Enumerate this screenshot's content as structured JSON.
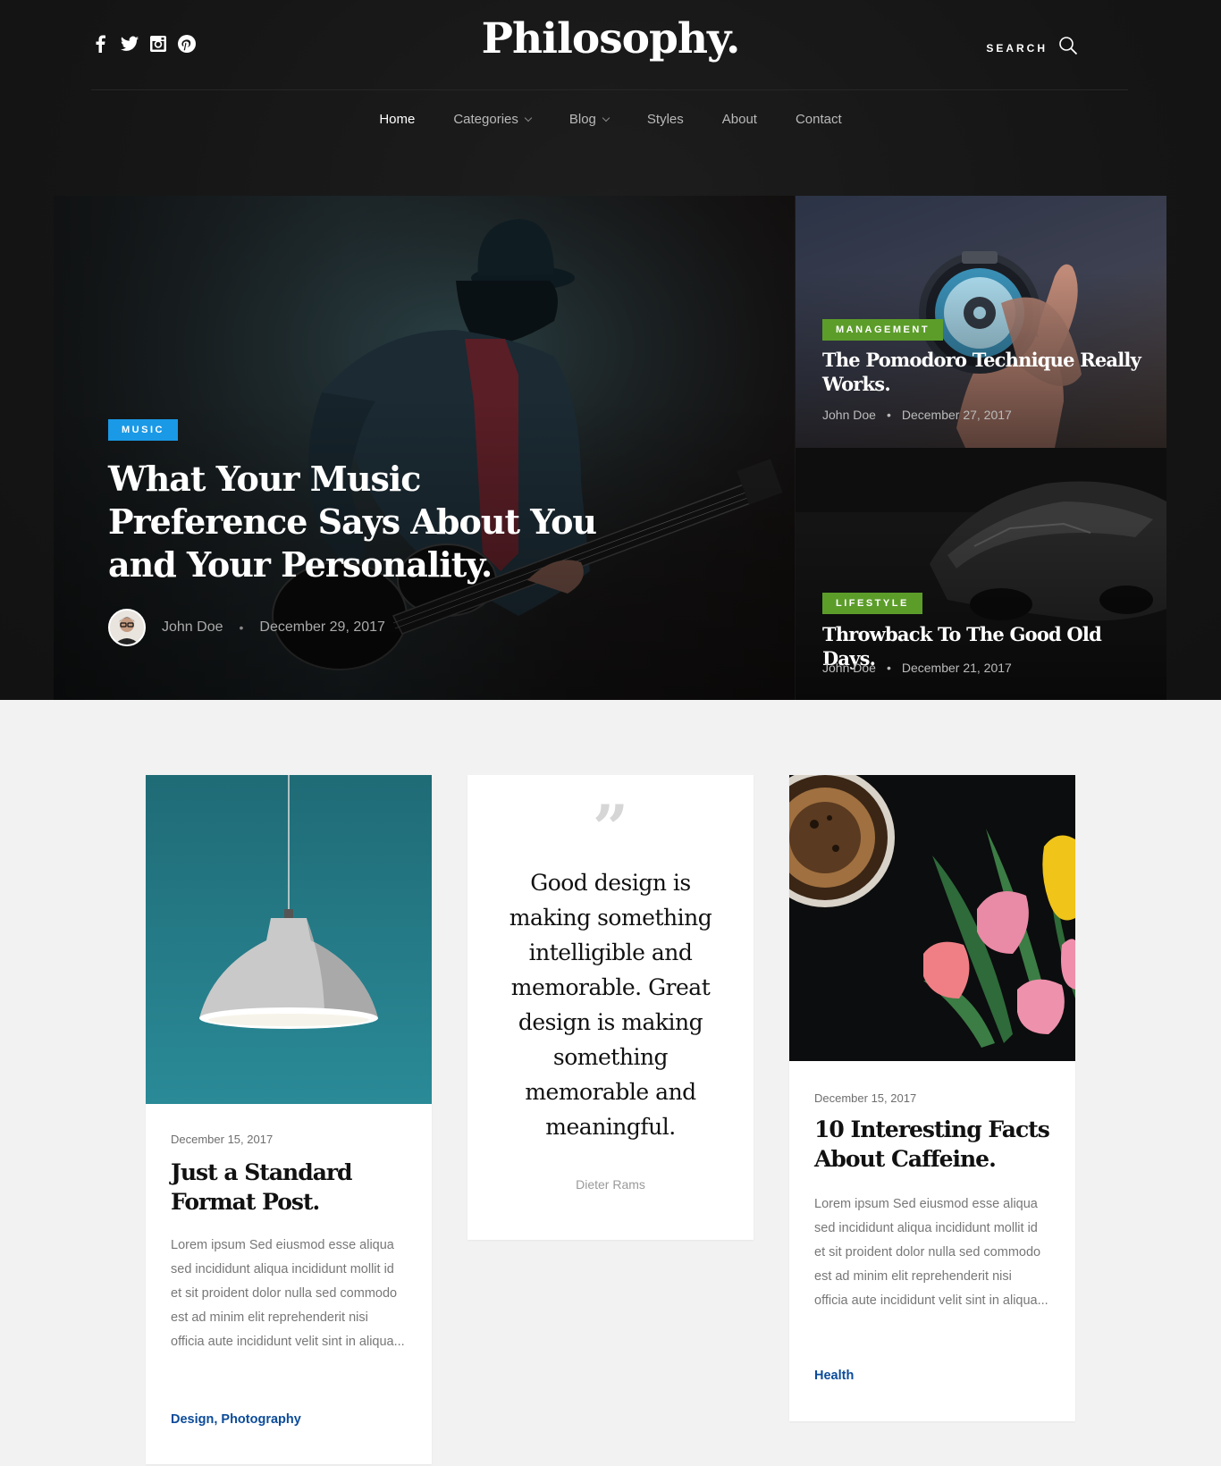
{
  "header": {
    "logo": "Philosophy.",
    "search_label": "SEARCH",
    "social": [
      "facebook-icon",
      "twitter-icon",
      "instagram-icon",
      "pinterest-icon"
    ]
  },
  "nav": {
    "items": [
      {
        "label": "Home",
        "active": true
      },
      {
        "label": "Categories",
        "dropdown": true
      },
      {
        "label": "Blog",
        "dropdown": true
      },
      {
        "label": "Styles"
      },
      {
        "label": "About"
      },
      {
        "label": "Contact"
      }
    ]
  },
  "featured": {
    "main": {
      "category": "MUSIC",
      "category_color": "#1a99e6",
      "title": "What Your Music Preference Says About You and Your Personality.",
      "author": "John Doe",
      "separator": "•",
      "date": "December 29, 2017"
    },
    "side": [
      {
        "category": "MANAGEMENT",
        "category_color": "#5c9d2a",
        "title": "The Pomodoro Technique Really Works.",
        "author": "John Doe",
        "separator": "•",
        "date": "December 27, 2017"
      },
      {
        "category": "LIFESTYLE",
        "category_color": "#5c9d2a",
        "title": "Throwback To The Good Old Days.",
        "author": "John Doe",
        "separator": "•",
        "date": "December 21, 2017"
      }
    ]
  },
  "cards": [
    {
      "date": "December 15, 2017",
      "title": "Just a Standard Format Post.",
      "excerpt": "Lorem ipsum Sed eiusmod esse aliqua sed incididunt aliqua incididunt mollit id et sit proident dolor nulla sed commodo est ad minim elit reprehenderit nisi officia aute incididunt velit sint in aliqua...",
      "categories": "Design, Photography"
    },
    {
      "quote_mark": "”",
      "quote": "Good design is making something intelligible and memorable. Great design is making something memorable and meaningful.",
      "author": "Dieter Rams"
    },
    {
      "date": "December 15, 2017",
      "title": "10 Interesting Facts About Caffeine.",
      "excerpt": "Lorem ipsum Sed eiusmod esse aliqua sed incididunt aliqua incididunt mollit id et sit proident dolor nulla sed commodo est ad minim elit reprehenderit nisi officia aute incididunt velit sint in aliqua...",
      "categories": "Health"
    }
  ]
}
